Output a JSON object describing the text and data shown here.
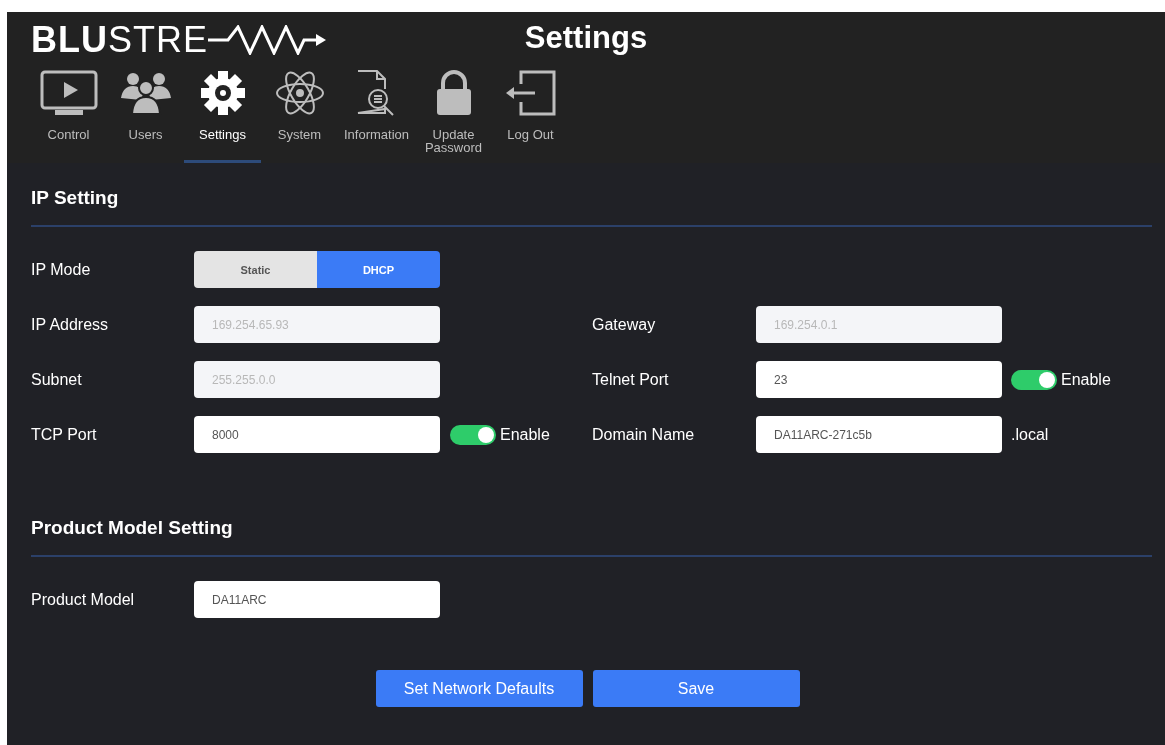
{
  "logo": {
    "bold": "BLU",
    "light": "STRE"
  },
  "page_title": "Settings",
  "nav": [
    {
      "label": "Control",
      "selected": false
    },
    {
      "label": "Users",
      "selected": false
    },
    {
      "label": "Settings",
      "selected": true
    },
    {
      "label": "System",
      "selected": false
    },
    {
      "label": "Information",
      "selected": false
    },
    {
      "label": "Update Password",
      "selected": false
    },
    {
      "label": "Log Out",
      "selected": false
    }
  ],
  "sections": [
    {
      "title": "IP Setting",
      "rows": [
        {
          "left": {
            "kind": "segmented",
            "label": "IP Mode",
            "options": [
              {
                "label": "Static",
                "selected": false
              },
              {
                "label": "DHCP",
                "selected": true
              }
            ]
          }
        },
        {
          "left": {
            "kind": "input",
            "label": "IP Address",
            "value": "169.254.65.93",
            "disabled": true
          },
          "right": {
            "kind": "input",
            "label": "Gateway",
            "value": "169.254.0.1",
            "disabled": true
          }
        },
        {
          "left": {
            "kind": "input",
            "label": "Subnet",
            "value": "255.255.0.0",
            "disabled": true
          },
          "right": {
            "kind": "input",
            "label": "Telnet Port",
            "value": "23",
            "disabled": false,
            "toggle": {
              "on": true,
              "label": "Enable"
            }
          }
        },
        {
          "left": {
            "kind": "input",
            "label": "TCP Port",
            "value": "8000",
            "disabled": false,
            "toggle": {
              "on": true,
              "label": "Enable"
            }
          },
          "right": {
            "kind": "input",
            "label": "Domain Name",
            "value": "DA11ARC-271c5b",
            "disabled": false,
            "suffix": ".local"
          }
        }
      ]
    },
    {
      "title": "Product Model Setting",
      "rows": [
        {
          "left": {
            "kind": "input",
            "label": "Product Model",
            "value": "DA11ARC",
            "disabled": false
          }
        }
      ]
    }
  ],
  "buttons": [
    "Set Network Defaults",
    "Save"
  ]
}
